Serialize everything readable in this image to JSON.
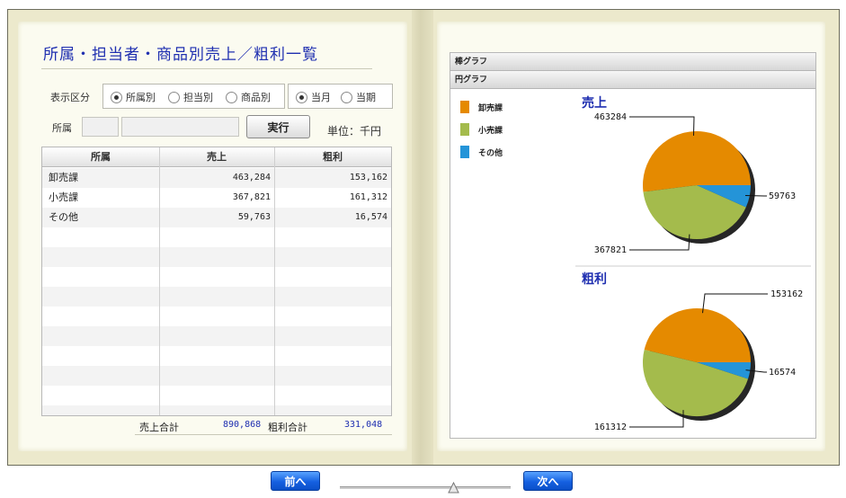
{
  "left": {
    "title": "所属・担当者・商品別売上／粗利一覧",
    "display_label": "表示区分",
    "radios_group1": [
      {
        "label": "所属別",
        "selected": true
      },
      {
        "label": "担当別",
        "selected": false
      },
      {
        "label": "商品別",
        "selected": false
      }
    ],
    "radios_group2": [
      {
        "label": "当月",
        "selected": true
      },
      {
        "label": "当期",
        "selected": false
      }
    ],
    "affil_label": "所属",
    "run_label": "実行",
    "unit_label": "単位：千円",
    "table": {
      "headers": [
        "所属",
        "売上",
        "粗利"
      ],
      "rows": [
        {
          "name": "卸売課",
          "sales": "463,284",
          "profit": "153,162"
        },
        {
          "name": "小売課",
          "sales": "367,821",
          "profit": "161,312"
        },
        {
          "name": "その他",
          "sales": "59,763",
          "profit": "16,574"
        }
      ]
    },
    "totals": {
      "sales_label": "売上合計",
      "sales_value": "890,868",
      "profit_label": "粗利合計",
      "profit_value": "331,048"
    }
  },
  "right": {
    "accordion": [
      "棒グラフ",
      "円グラフ"
    ],
    "legend": [
      {
        "name": "卸売課",
        "color": "#e58a00"
      },
      {
        "name": "小売課",
        "color": "#a4bb4c"
      },
      {
        "name": "その他",
        "color": "#2494d8"
      }
    ]
  },
  "chart_data": [
    {
      "type": "pie",
      "title": "売上",
      "categories": [
        "卸売課",
        "小売課",
        "その他"
      ],
      "values": [
        463284,
        367821,
        59763
      ],
      "labels": [
        "463284",
        "367821",
        "59763"
      ]
    },
    {
      "type": "pie",
      "title": "粗利",
      "categories": [
        "卸売課",
        "小売課",
        "その他"
      ],
      "values": [
        153162,
        161312,
        16574
      ],
      "labels": [
        "153162",
        "161312",
        "16574"
      ]
    }
  ],
  "nav": {
    "prev_label": "前へ",
    "next_label": "次へ"
  }
}
